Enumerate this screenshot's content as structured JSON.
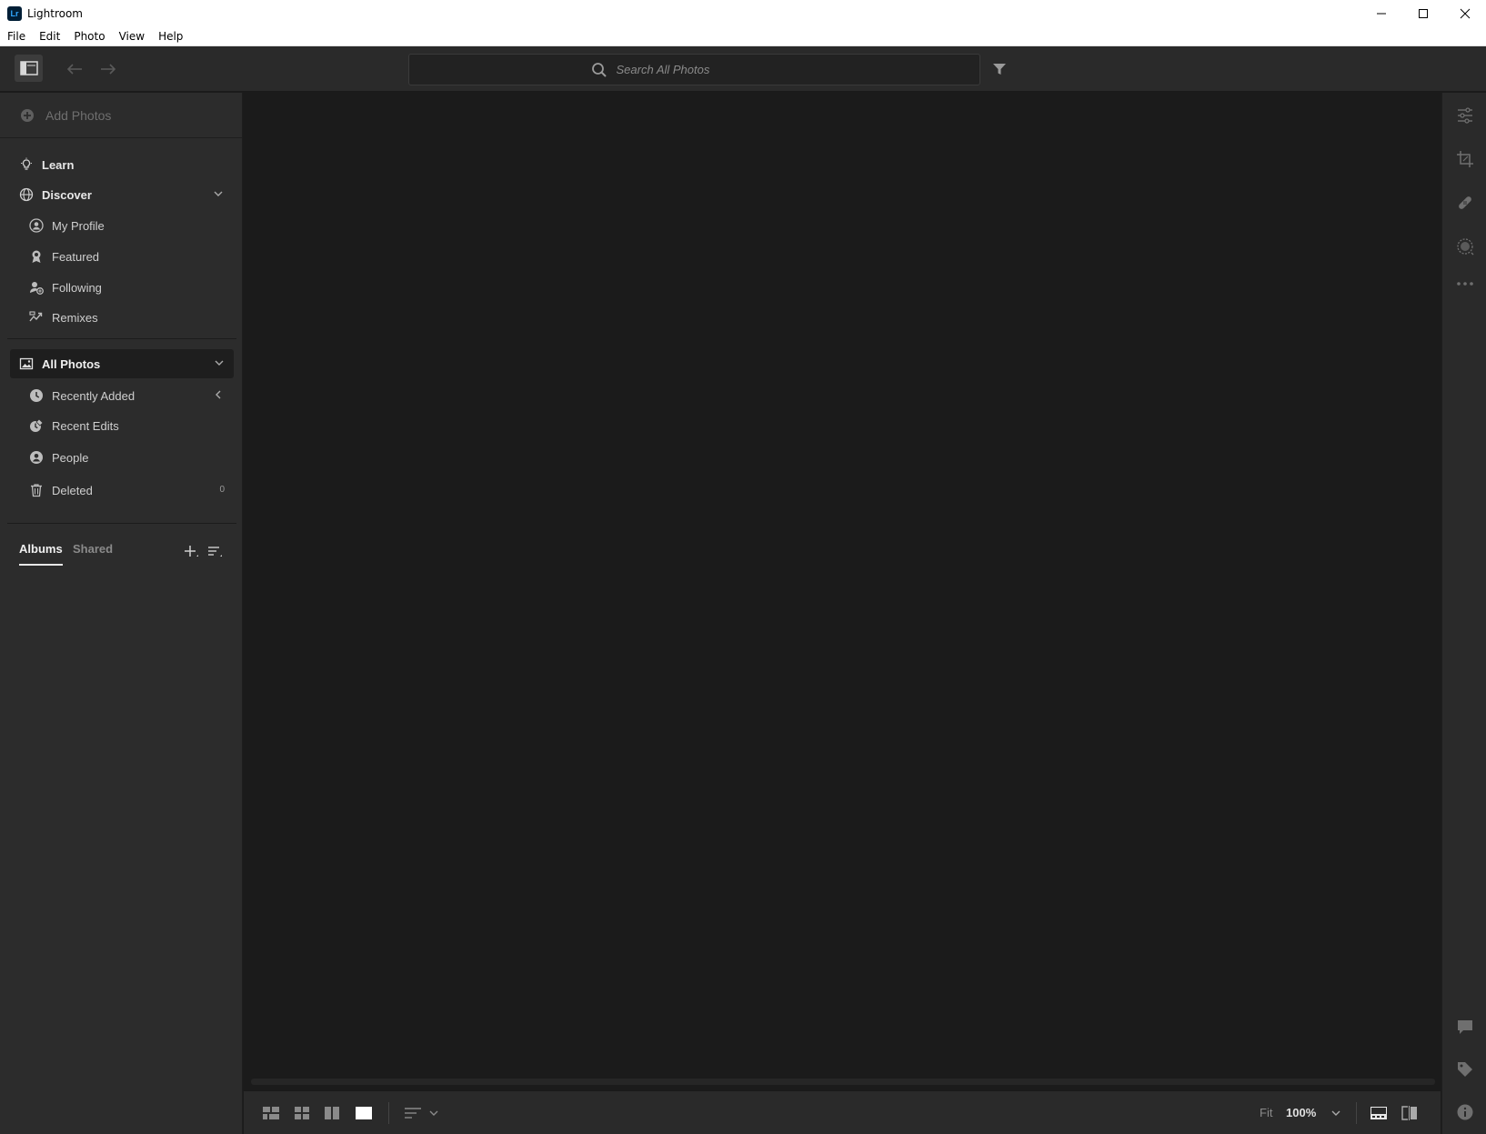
{
  "window": {
    "title": "Lightroom",
    "logo_text": "Lr"
  },
  "menu": [
    "File",
    "Edit",
    "Photo",
    "View",
    "Help"
  ],
  "search": {
    "placeholder": "Search All Photos"
  },
  "sidebar": {
    "add_photos": "Add Photos",
    "learn": "Learn",
    "discover": "Discover",
    "discover_items": [
      "My Profile",
      "Featured",
      "Following",
      "Remixes"
    ],
    "all_photos": "All Photos",
    "photo_items": [
      "Recently Added",
      "Recent Edits",
      "People",
      "Deleted"
    ],
    "deleted_count": "0",
    "tabs": {
      "albums": "Albums",
      "shared": "Shared"
    }
  },
  "bottombar": {
    "fit_label": "Fit",
    "zoom_label": "100%"
  },
  "colors": {
    "chrome_bg": "#2a2a2a",
    "main_bg": "#1b1b1b",
    "sidebar_bg": "#2c2c2c",
    "logo_bg": "#001e36",
    "logo_fg": "#31a8ff"
  }
}
